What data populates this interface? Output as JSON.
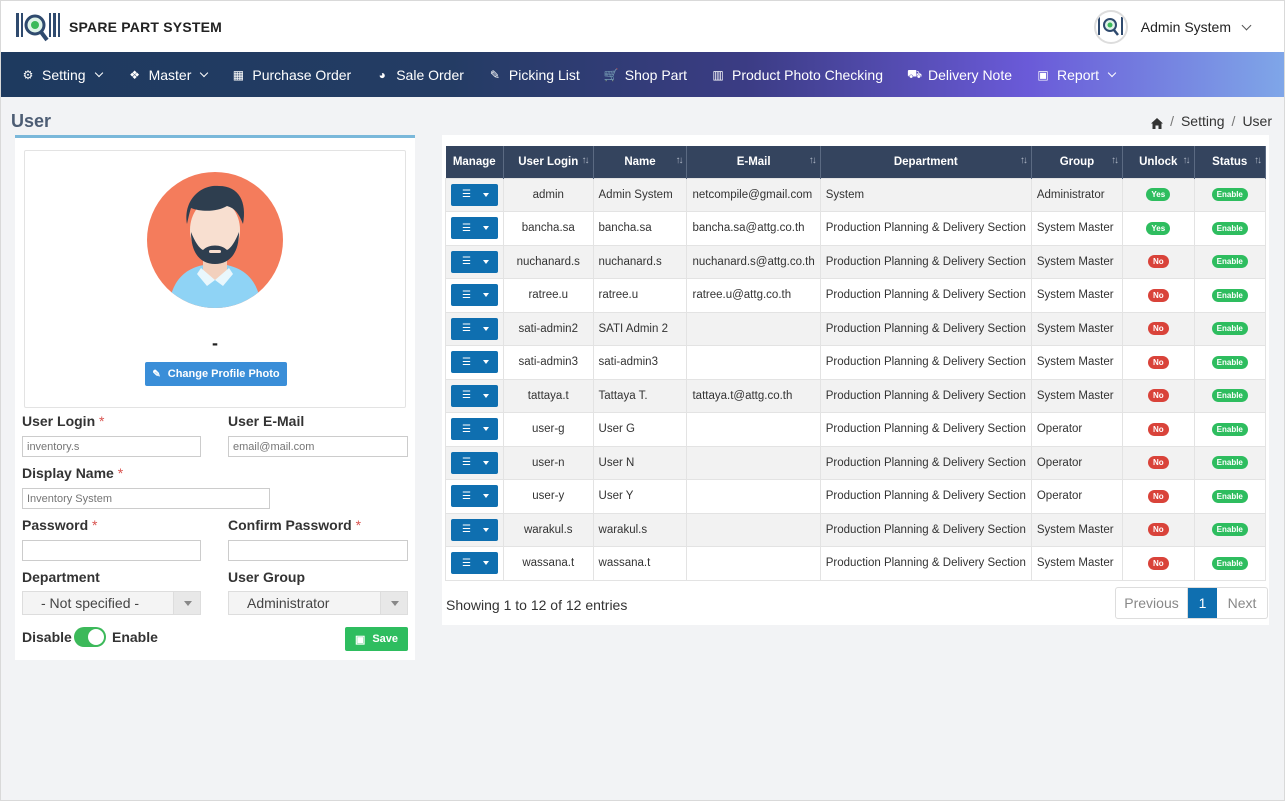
{
  "app": {
    "title": "SPARE PART SYSTEM"
  },
  "user_menu": {
    "name": "Admin System"
  },
  "nav": [
    {
      "label": "Setting",
      "icon": "gears-icon",
      "glyph": "⚙",
      "dropdown": true
    },
    {
      "label": "Master",
      "icon": "cubes-icon",
      "glyph": "❖",
      "dropdown": true
    },
    {
      "label": "Purchase Order",
      "icon": "table-icon",
      "glyph": "▦",
      "dropdown": false
    },
    {
      "label": "Sale Order",
      "icon": "pie-chart-icon",
      "glyph": "◕",
      "dropdown": false
    },
    {
      "label": "Picking List",
      "icon": "clipboard-icon",
      "glyph": "✎",
      "dropdown": false
    },
    {
      "label": "Shop Part",
      "icon": "cart-icon",
      "glyph": "🛒",
      "dropdown": false
    },
    {
      "label": "Product Photo Checking",
      "icon": "barcode-icon",
      "glyph": "▥",
      "dropdown": false
    },
    {
      "label": "Delivery Note",
      "icon": "truck-icon",
      "glyph": "⛟",
      "dropdown": false
    },
    {
      "label": "Report",
      "icon": "report-icon",
      "glyph": "▣",
      "dropdown": true
    }
  ],
  "page": {
    "title": "User",
    "breadcrumb": [
      "Setting",
      "User"
    ]
  },
  "profile": {
    "display_name_value": "-",
    "change_photo_label": "Change Profile Photo"
  },
  "form": {
    "user_login_label": "User Login",
    "user_login_placeholder": "inventory.s",
    "user_email_label": "User E-Mail",
    "user_email_placeholder": "email@mail.com",
    "display_name_label": "Display Name",
    "display_name_placeholder": "Inventory System",
    "password_label": "Password",
    "confirm_password_label": "Confirm Password",
    "department_label": "Department",
    "department_value": "- Not specified -",
    "user_group_label": "User Group",
    "user_group_value": "Administrator",
    "disable_label": "Disable",
    "enable_label": "Enable",
    "enabled": true,
    "save_label": "Save",
    "required_mark": "*"
  },
  "table": {
    "columns": [
      "Manage",
      "User Login",
      "Name",
      "E-Mail",
      "Department",
      "Group",
      "Unlock",
      "Status"
    ],
    "rows": [
      {
        "login": "admin",
        "name": "Admin System",
        "email": "netcompile@gmail.com",
        "department": "System",
        "group": "Administrator",
        "unlock": "Yes",
        "status": "Enable"
      },
      {
        "login": "bancha.sa",
        "name": "bancha.sa",
        "email": "bancha.sa@attg.co.th",
        "department": "Production Planning & Delivery Section",
        "group": "System Master",
        "unlock": "Yes",
        "status": "Enable"
      },
      {
        "login": "nuchanard.s",
        "name": "nuchanard.s",
        "email": "nuchanard.s@attg.co.th",
        "department": "Production Planning & Delivery Section",
        "group": "System Master",
        "unlock": "No",
        "status": "Enable"
      },
      {
        "login": "ratree.u",
        "name": "ratree.u",
        "email": "ratree.u@attg.co.th",
        "department": "Production Planning & Delivery Section",
        "group": "System Master",
        "unlock": "No",
        "status": "Enable"
      },
      {
        "login": "sati-admin2",
        "name": "SATI Admin 2",
        "email": "",
        "department": "Production Planning & Delivery Section",
        "group": "System Master",
        "unlock": "No",
        "status": "Enable"
      },
      {
        "login": "sati-admin3",
        "name": "sati-admin3",
        "email": "",
        "department": "Production Planning & Delivery Section",
        "group": "System Master",
        "unlock": "No",
        "status": "Enable"
      },
      {
        "login": "tattaya.t",
        "name": "Tattaya T.",
        "email": "tattaya.t@attg.co.th",
        "department": "Production Planning & Delivery Section",
        "group": "System Master",
        "unlock": "No",
        "status": "Enable"
      },
      {
        "login": "user-g",
        "name": "User G",
        "email": "",
        "department": "Production Planning & Delivery Section",
        "group": "Operator",
        "unlock": "No",
        "status": "Enable"
      },
      {
        "login": "user-n",
        "name": "User N",
        "email": "",
        "department": "Production Planning & Delivery Section",
        "group": "Operator",
        "unlock": "No",
        "status": "Enable"
      },
      {
        "login": "user-y",
        "name": "User Y",
        "email": "",
        "department": "Production Planning & Delivery Section",
        "group": "Operator",
        "unlock": "No",
        "status": "Enable"
      },
      {
        "login": "warakul.s",
        "name": "warakul.s",
        "email": "",
        "department": "Production Planning & Delivery Section",
        "group": "System Master",
        "unlock": "No",
        "status": "Enable"
      },
      {
        "login": "wassana.t",
        "name": "wassana.t",
        "email": "",
        "department": "Production Planning & Delivery Section",
        "group": "System Master",
        "unlock": "No",
        "status": "Enable"
      }
    ],
    "info": "Showing 1 to 12 of 12 entries",
    "pagination": {
      "prev": "Previous",
      "current": "1",
      "next": "Next"
    }
  },
  "colors": {
    "nav_start": "#1e3a5f",
    "nav_end": "#7fa6e8",
    "primary": "#0f6fb0",
    "success": "#2ebd5f",
    "danger": "#d9433a",
    "table_header": "#34445e"
  }
}
